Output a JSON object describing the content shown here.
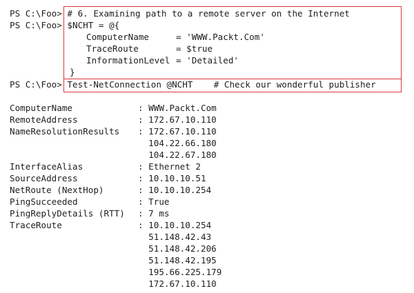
{
  "prompt": "PS C:\\Foo>",
  "commands": {
    "comment_line": "# 6. Examining path to a remote server on the Internet",
    "hash_open": "$NCHT = @{",
    "params": [
      {
        "name": "ComputerName",
        "eq": "= ",
        "value": "'WWW.Packt.Com'"
      },
      {
        "name": "TraceRoute",
        "eq": "= ",
        "value": "$true"
      },
      {
        "name": "InformationLevel",
        "eq": "= ",
        "value": "'Detailed'"
      }
    ],
    "hash_close": "}",
    "run_line": "Test-NetConnection @NCHT    # Check our wonderful publisher"
  },
  "output": [
    {
      "key": "ComputerName",
      "values": [
        "WWW.Packt.Com"
      ]
    },
    {
      "key": "RemoteAddress",
      "values": [
        "172.67.10.110"
      ]
    },
    {
      "key": "NameResolutionResults",
      "values": [
        "172.67.10.110",
        "104.22.66.180",
        "104.22.67.180"
      ]
    },
    {
      "key": "InterfaceAlias",
      "values": [
        "Ethernet 2"
      ]
    },
    {
      "key": "SourceAddress",
      "values": [
        "10.10.10.51"
      ]
    },
    {
      "key": "NetRoute (NextHop)",
      "values": [
        "10.10.10.254"
      ]
    },
    {
      "key": "PingSucceeded",
      "values": [
        "True"
      ]
    },
    {
      "key": "PingReplyDetails (RTT)",
      "values": [
        "7 ms"
      ]
    },
    {
      "key": "TraceRoute",
      "values": [
        "10.10.10.254",
        "51.148.42.43",
        "51.148.42.206",
        "51.148.42.195",
        "195.66.225.179",
        "172.67.10.110"
      ]
    }
  ],
  "separator": ": ",
  "colors": {
    "highlight_border": "#d9363e",
    "text": "#1e1e1e",
    "background": "#ffffff"
  }
}
